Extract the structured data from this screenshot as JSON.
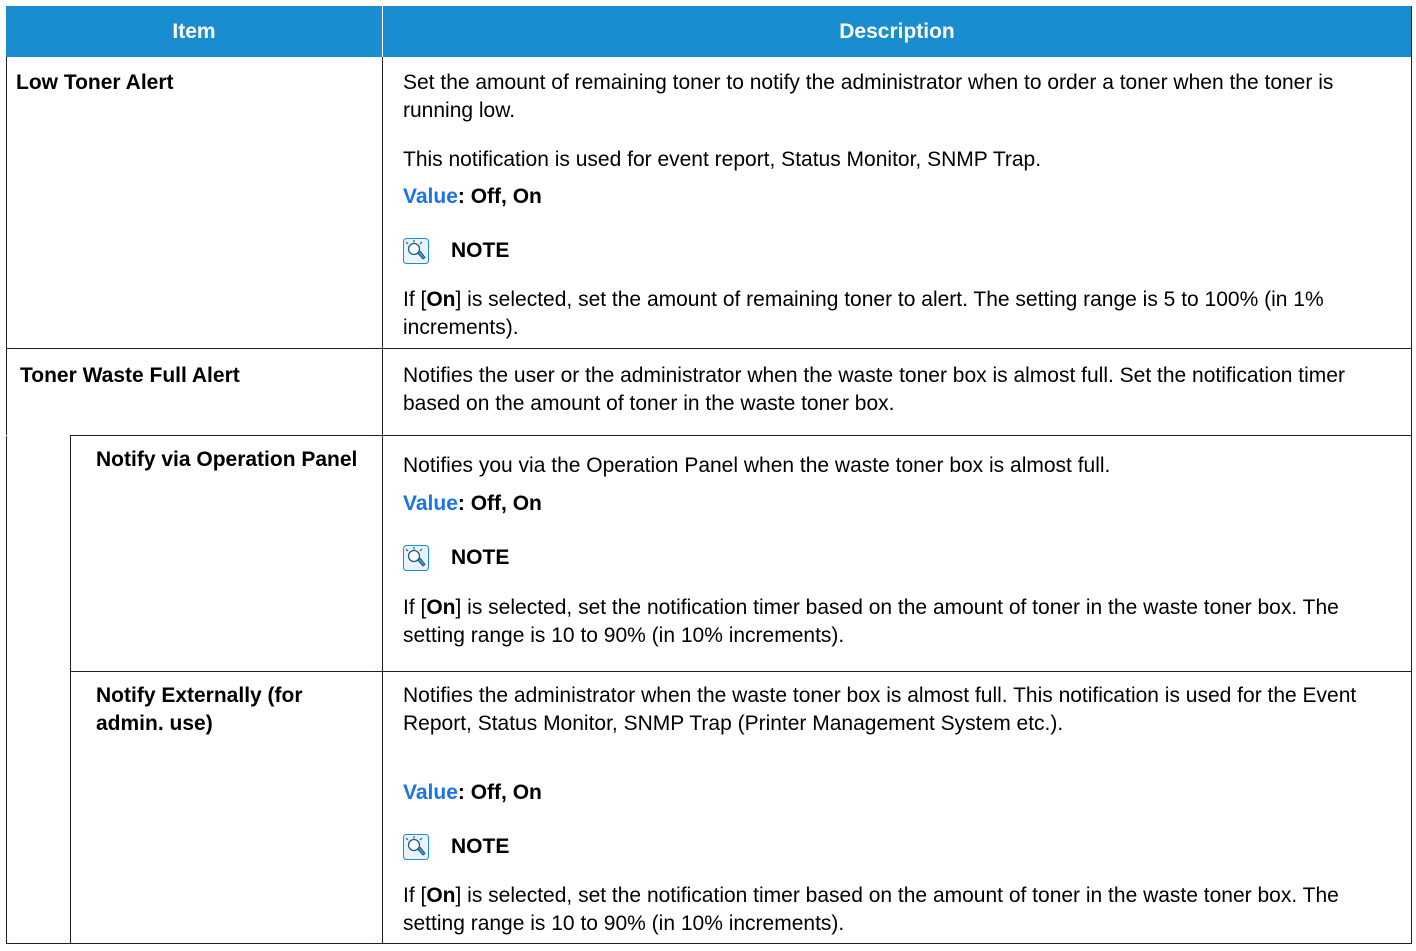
{
  "header": {
    "item": "Item",
    "description": "Description"
  },
  "rows": [
    {
      "item": "Low Toner Alert",
      "desc1": "Set the amount of remaining toner to notify the administrator when to order a toner when the toner is running low.",
      "desc2": "This notification is used for event report, Status Monitor, SNMP Trap.",
      "value_label": "Value",
      "value_text": ": Off, On",
      "note_title": "NOTE",
      "note_before": "If [",
      "note_bold": "On",
      "note_after": "] is selected, set the amount of remaining toner to alert. The setting range is 5 to 100% (in 1% increments)."
    },
    {
      "item": "Toner Waste Full Alert",
      "desc1": "Notifies the user or the administrator when the waste toner box is almost full. Set the notification timer based on the amount of toner in the waste toner box."
    },
    {
      "item": "Notify via Operation Panel",
      "desc1": "Notifies you via the Operation Panel when the waste toner box is almost full.",
      "value_label": "Value",
      "value_text": ": Off, On",
      "note_title": "NOTE",
      "note_before": "If [",
      "note_bold": "On",
      "note_after": "] is selected, set the notification timer based on the amount of toner in the waste toner box. The setting range is 10 to 90% (in 10% increments)."
    },
    {
      "item": "Notify Externally (for admin. use)",
      "desc1": "Notifies the administrator when the waste toner box is almost full. This notification is used for the Event Report, Status Monitor, SNMP Trap (Printer Management System etc.).",
      "value_label": "Value",
      "value_text": ": Off, On",
      "note_title": "NOTE",
      "note_before": "If [",
      "note_bold": "On",
      "note_after": "] is selected, set the notification timer based on the amount of toner in the waste toner box. The setting range is 10 to 90% (in 10% increments)."
    }
  ],
  "colors": {
    "header_bg": "#1a8cd0",
    "value_label": "#1a73e8",
    "rule": "#231f20"
  },
  "icons": {
    "note": "note-hand-icon"
  }
}
